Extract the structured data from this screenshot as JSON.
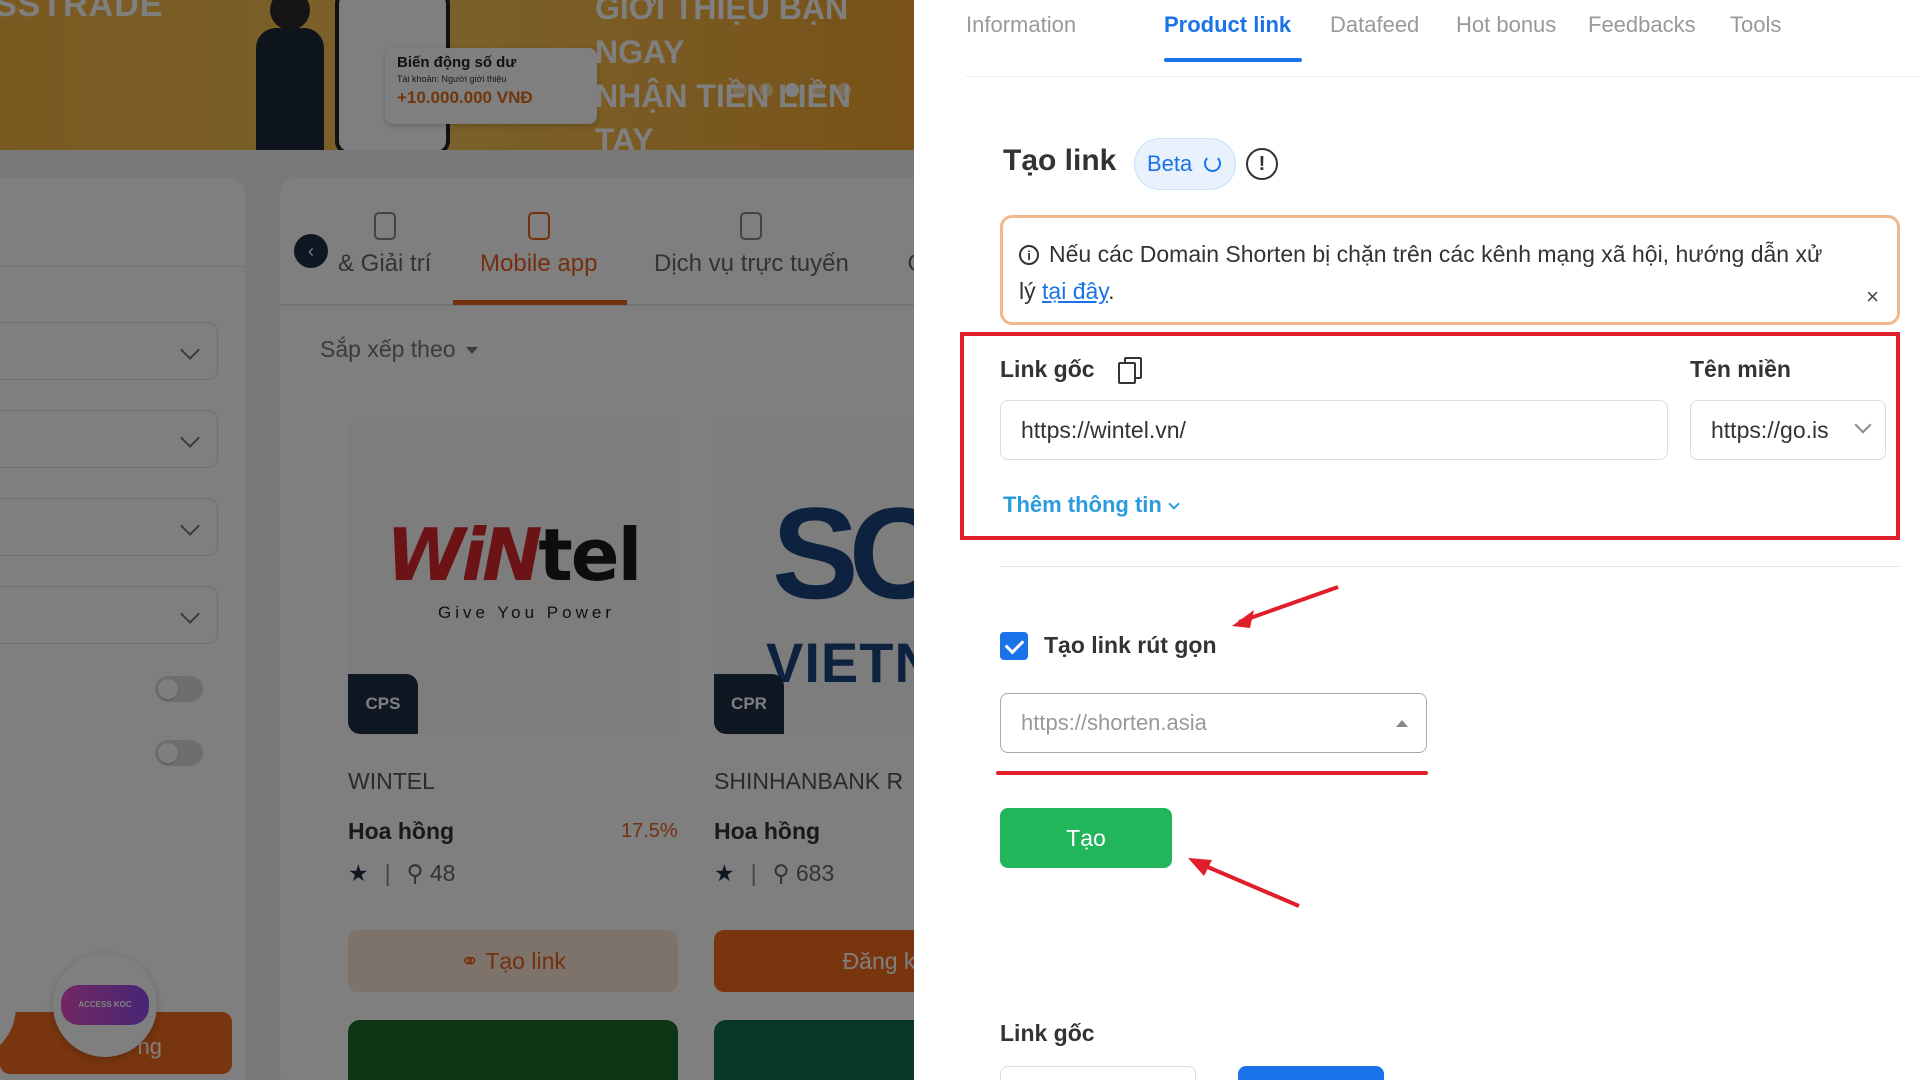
{
  "background": {
    "banner": {
      "brand": "SSTRADE",
      "card_title": "Biến động số dư",
      "card_subtitle": "Tài khoản: Người giới thiệu",
      "card_amount": "+10.000.000 VNĐ",
      "headline_line1": "GIỚI THIỆU BẠN NGAY",
      "headline_line2": "NHẬN TIỀN LIỀN TAY",
      "dot_count": 5,
      "active_dot": 2
    },
    "left_button": "ng",
    "badge": "ACCESS KOC",
    "catalog": {
      "tabs": [
        {
          "label": "& Giải trí",
          "active": false
        },
        {
          "label": "Mobile app",
          "active": true
        },
        {
          "label": "Dịch vụ trực tuyến",
          "active": false
        },
        {
          "label": "C",
          "active": false
        }
      ],
      "sort_label": "Sắp xếp theo",
      "cards": [
        {
          "logo_main_red": "WiN",
          "logo_main_dark": "tel",
          "logo_tagline": "Give You Power",
          "tag": "CPS",
          "name": "WINTEL",
          "commission_label": "Hoa hồng",
          "commission_rate": "17.5%",
          "star": "★",
          "separator": "|",
          "users": "48",
          "button": "Tạo link",
          "button_icon": "link-icon",
          "accent": "#e8601c"
        },
        {
          "logo_main": "SO",
          "logo_sub": "VIETN",
          "tag": "CPR",
          "name": "SHINHANBANK R",
          "commission_label": "Hoa hồng",
          "commission_rate": "",
          "star": "★",
          "separator": "|",
          "users": "683",
          "button": "Đăng k",
          "accent": "#f06a1d"
        }
      ]
    }
  },
  "drawer": {
    "tabs": [
      {
        "label": "Information",
        "active": false
      },
      {
        "label": "Product link",
        "active": true
      },
      {
        "label": "Datafeed",
        "active": false
      },
      {
        "label": "Hot bonus",
        "active": false
      },
      {
        "label": "Feedbacks",
        "active": false
      },
      {
        "label": "Tools",
        "active": false
      }
    ],
    "title": "Tạo link",
    "beta_label": "Beta",
    "info_icon": "!",
    "notice": {
      "text": "Nếu các Domain Shorten bị chặn trên các kênh mạng xã hội, hướng dẫn xử lý",
      "link_text": "tại đây",
      "suffix": ".",
      "close": "×",
      "border_color": "#f3b78c"
    },
    "form": {
      "original_link_label": "Link gốc",
      "original_link_value": "https://wintel.vn/",
      "domain_label": "Tên miền",
      "domain_value": "https://go.is",
      "more_info_label": "Thêm thông tin"
    },
    "shorten": {
      "checkbox_label": "Tạo link rút gọn",
      "checked": true,
      "select_value": "https://shorten.asia"
    },
    "create_button": "Tạo",
    "bottom_section_label": "Link gốc",
    "colors": {
      "primary": "#1a73e8",
      "success": "#22b65a",
      "annotation_red": "#e01f2a",
      "link_blue": "#2b9be0"
    }
  }
}
